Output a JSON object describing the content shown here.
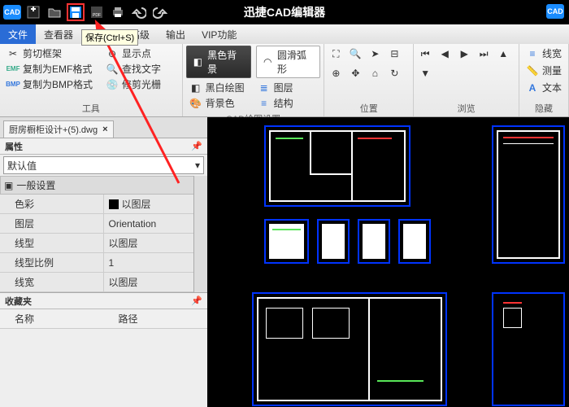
{
  "app": {
    "title": "迅捷CAD编辑器",
    "badge": "CAD"
  },
  "menu": {
    "file": "文件",
    "view": "查看器",
    "advanced": "高级",
    "output": "输出",
    "vip": "VIP功能"
  },
  "tooltip": {
    "save": "保存(Ctrl+S)"
  },
  "ribbon": {
    "group_tools": "工具",
    "clip_frame": "剪切框架",
    "copy_emf": "复制为EMF格式",
    "copy_bmp": "复制为BMP格式",
    "show_point": "显示点",
    "find_text": "查找文字",
    "trim_disc": "修剪光栅",
    "group_cad": "CAD绘图设置",
    "black_bg": "黑色背景",
    "bw_draw": "黑白绘图",
    "bg_color": "背景色",
    "smooth_arc": "圆滑弧形",
    "layer": "图层",
    "structure": "结构",
    "group_pos": "位置",
    "group_browse": "浏览",
    "linewidth": "线宽",
    "measure": "测量",
    "text": "文本",
    "group_hide": "隐藏"
  },
  "doc": {
    "tab": "厨房橱柜设计+(5).dwg",
    "close": "×"
  },
  "props": {
    "title": "属性",
    "default": "默认值",
    "general": "一般设置",
    "rows": {
      "color_k": "色彩",
      "color_v": "以图层",
      "layer_k": "图层",
      "layer_v": "Orientation",
      "linetype_k": "线型",
      "linetype_v": "以图层",
      "linescale_k": "线型比例",
      "linescale_v": "1",
      "lineweight_k": "线宽",
      "lineweight_v": "以图层"
    }
  },
  "fav": {
    "title": "收藏夹",
    "col_name": "名称",
    "col_path": "路径"
  }
}
